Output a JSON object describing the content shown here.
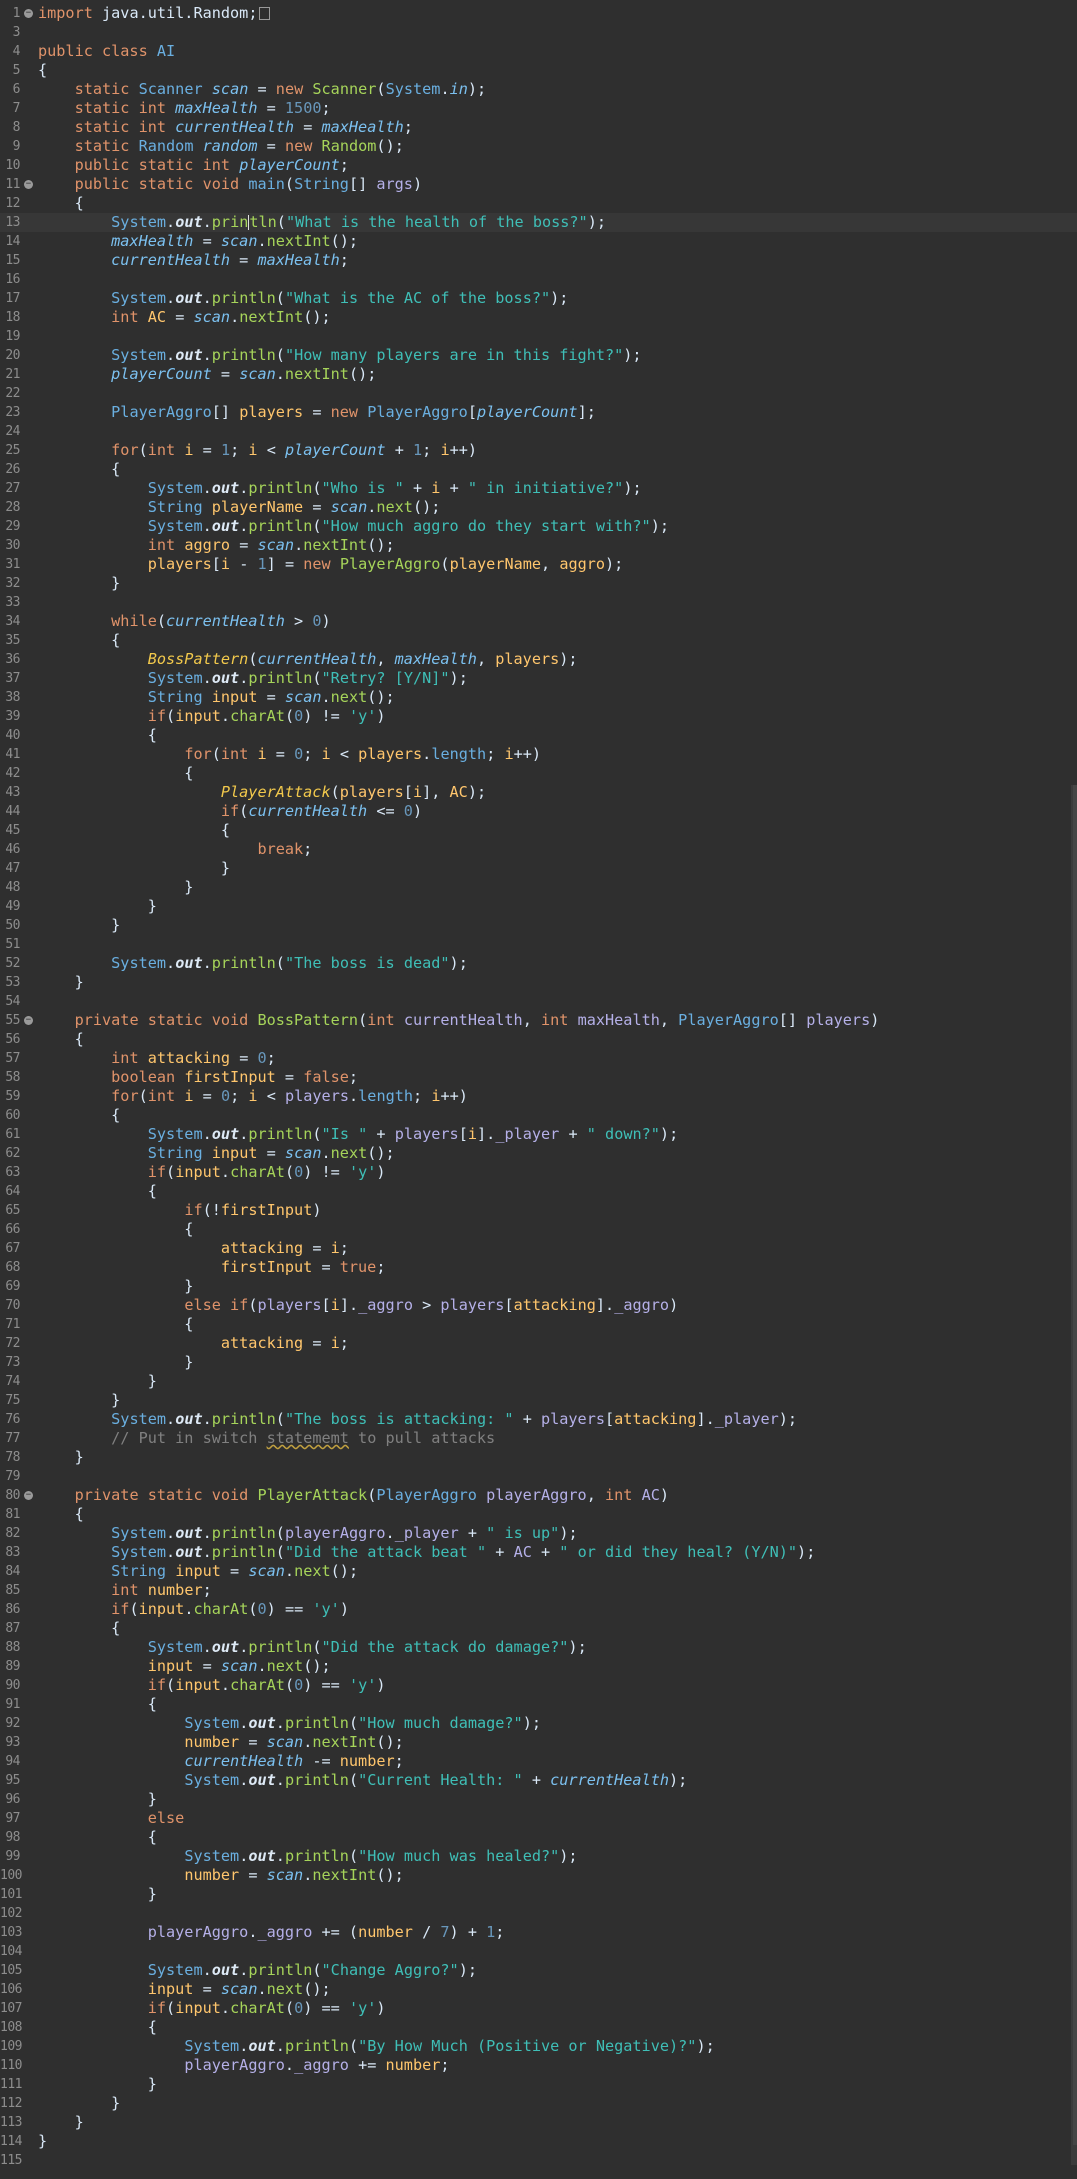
{
  "editor": {
    "language": "java",
    "current_line": 13,
    "lines": [
      {
        "n": "1",
        "fold": true,
        "html": "<span class='k'>import</span> java.util.Random;<span style='display:inline-block;width:9px;height:11px;border:1px solid #9a9a9a;vertical-align:middle;margin-left:2px'></span>"
      },
      {
        "n": "3",
        "html": ""
      },
      {
        "n": "4",
        "html": "<span class='k'>public class</span> <span class='t'>AI</span>"
      },
      {
        "n": "5",
        "html": "{"
      },
      {
        "n": "6",
        "html": "    <span class='k'>static</span> <span class='t'>Scanner</span> <span class='sf'>scan</span> = <span class='k'>new</span> <span class='f'>Scanner</span>(<span class='t'>System</span>.<span class='sf'>in</span>);"
      },
      {
        "n": "7",
        "html": "    <span class='k'>static int</span> <span class='sf'>maxHealth</span> = <span class='n'>1500</span>;"
      },
      {
        "n": "8",
        "html": "    <span class='k'>static int</span> <span class='sf'>currentHealth</span> = <span class='sf'>maxHealth</span>;"
      },
      {
        "n": "9",
        "html": "    <span class='k'>static</span> <span class='t'>Random</span> <span class='sf'>random</span> = <span class='k'>new</span> <span class='f'>Random</span>();"
      },
      {
        "n": "10",
        "html": "    <span class='k'>public static int</span> <span class='sf'>playerCount</span>;"
      },
      {
        "n": "11",
        "fold": true,
        "html": "    <span class='k'>public static void</span> <span class='t'>main</span>(<span class='t'>String</span>[] <span class='fld'>args</span>)"
      },
      {
        "n": "12",
        "html": "    {"
      },
      {
        "n": "13",
        "html": "        <span class='t'>System</span>.<span class='so'>out</span>.<span class='f'>prin</span><span class='cursor'></span><span class='f'>tln</span>(<span class='s'>\"What is the health of the boss?\"</span>);"
      },
      {
        "n": "14",
        "html": "        <span class='sf'>maxHealth</span> = <span class='sf'>scan</span>.<span class='f'>nextInt</span>();"
      },
      {
        "n": "15",
        "html": "        <span class='sf'>currentHealth</span> = <span class='sf'>maxHealth</span>;"
      },
      {
        "n": "16",
        "html": ""
      },
      {
        "n": "17",
        "html": "        <span class='t'>System</span>.<span class='so'>out</span>.<span class='f'>println</span>(<span class='s'>\"What is the AC of the boss?\"</span>);"
      },
      {
        "n": "18",
        "html": "        <span class='k'>int</span> <span class='p'>AC</span> = <span class='sf'>scan</span>.<span class='f'>nextInt</span>();"
      },
      {
        "n": "19",
        "html": ""
      },
      {
        "n": "20",
        "html": "        <span class='t'>System</span>.<span class='so'>out</span>.<span class='f'>println</span>(<span class='s'>\"How many players are in this fight?\"</span>);"
      },
      {
        "n": "21",
        "html": "        <span class='sf'>playerCount</span> = <span class='sf'>scan</span>.<span class='f'>nextInt</span>();"
      },
      {
        "n": "22",
        "html": ""
      },
      {
        "n": "23",
        "html": "        <span class='t'>PlayerAggro</span>[] <span class='p'>players</span> = <span class='k'>new</span> <span class='t'>PlayerAggro</span>[<span class='sf'>playerCount</span>];"
      },
      {
        "n": "24",
        "html": ""
      },
      {
        "n": "25",
        "html": "        <span class='k'>for</span>(<span class='k'>int</span> <span class='p'>i</span> = <span class='n'>1</span>; <span class='p'>i</span> &lt; <span class='sf'>playerCount</span> + <span class='n'>1</span>; <span class='p'>i</span>++)"
      },
      {
        "n": "26",
        "html": "        {"
      },
      {
        "n": "27",
        "html": "            <span class='t'>System</span>.<span class='so'>out</span>.<span class='f'>println</span>(<span class='s'>\"Who is \"</span> + <span class='p'>i</span> + <span class='s'>\" in initiative?\"</span>);"
      },
      {
        "n": "28",
        "html": "            <span class='t'>String</span> <span class='p'>playerName</span> = <span class='sf'>scan</span>.<span class='f'>next</span>();"
      },
      {
        "n": "29",
        "html": "            <span class='t'>System</span>.<span class='so'>out</span>.<span class='f'>println</span>(<span class='s'>\"How much aggro do they start with?\"</span>);"
      },
      {
        "n": "30",
        "html": "            <span class='k'>int</span> <span class='p'>aggro</span> = <span class='sf'>scan</span>.<span class='f'>nextInt</span>();"
      },
      {
        "n": "31",
        "html": "            <span class='p'>players</span>[<span class='p'>i</span> - <span class='n'>1</span>] = <span class='k'>new</span> <span class='f'>PlayerAggro</span>(<span class='p'>playerName</span>, <span class='p'>aggro</span>);"
      },
      {
        "n": "32",
        "html": "        }"
      },
      {
        "n": "33",
        "html": ""
      },
      {
        "n": "34",
        "html": "        <span class='k'>while</span>(<span class='sf'>currentHealth</span> &gt; <span class='n'>0</span>)"
      },
      {
        "n": "35",
        "html": "        {"
      },
      {
        "n": "36",
        "html": "            <span class='sm'>BossPattern</span>(<span class='sf'>currentHealth</span>, <span class='sf'>maxHealth</span>, <span class='p'>players</span>);"
      },
      {
        "n": "37",
        "html": "            <span class='t'>System</span>.<span class='so'>out</span>.<span class='f'>println</span>(<span class='s'>\"Retry? [Y/N]\"</span>);"
      },
      {
        "n": "38",
        "html": "            <span class='t'>String</span> <span class='p'>input</span> = <span class='sf'>scan</span>.<span class='f'>next</span>();"
      },
      {
        "n": "39",
        "html": "            <span class='k'>if</span>(<span class='p'>input</span>.<span class='f'>charAt</span>(<span class='n'>0</span>) != <span class='s'>'y'</span>)"
      },
      {
        "n": "40",
        "html": "            {"
      },
      {
        "n": "41",
        "html": "                <span class='k'>for</span>(<span class='k'>int</span> <span class='p'>i</span> = <span class='n'>0</span>; <span class='p'>i</span> &lt; <span class='p'>players</span>.<span class='t'>length</span>; <span class='p'>i</span>++)"
      },
      {
        "n": "42",
        "html": "                {"
      },
      {
        "n": "43",
        "html": "                    <span class='sm'>PlayerAttack</span>(<span class='p'>players</span>[<span class='p'>i</span>], <span class='p'>AC</span>);"
      },
      {
        "n": "44",
        "html": "                    <span class='k'>if</span>(<span class='sf'>currentHealth</span> &lt;= <span class='n'>0</span>)"
      },
      {
        "n": "45",
        "html": "                    {"
      },
      {
        "n": "46",
        "html": "                        <span class='k'>break</span>;"
      },
      {
        "n": "47",
        "html": "                    }"
      },
      {
        "n": "48",
        "html": "                }"
      },
      {
        "n": "49",
        "html": "            }"
      },
      {
        "n": "50",
        "html": "        }"
      },
      {
        "n": "51",
        "html": ""
      },
      {
        "n": "52",
        "html": "        <span class='t'>System</span>.<span class='so'>out</span>.<span class='f'>println</span>(<span class='s'>\"The boss is dead\"</span>);"
      },
      {
        "n": "53",
        "html": "    }"
      },
      {
        "n": "54",
        "html": ""
      },
      {
        "n": "55",
        "fold": true,
        "html": "    <span class='k'>private static void</span> <span class='f'>BossPattern</span>(<span class='k'>int</span> <span class='fld'>currentHealth</span>, <span class='k'>int</span> <span class='fld'>maxHealth</span>, <span class='t'>PlayerAggro</span>[] <span class='fld'>players</span>)"
      },
      {
        "n": "56",
        "html": "    {"
      },
      {
        "n": "57",
        "html": "        <span class='k'>int</span> <span class='p'>attacking</span> = <span class='n'>0</span>;"
      },
      {
        "n": "58",
        "html": "        <span class='k'>boolean</span> <span class='p'>firstInput</span> = <span class='k'>false</span>;"
      },
      {
        "n": "59",
        "html": "        <span class='k'>for</span>(<span class='k'>int</span> <span class='p'>i</span> = <span class='n'>0</span>; <span class='p'>i</span> &lt; <span class='fld'>players</span>.<span class='t'>length</span>; <span class='p'>i</span>++)"
      },
      {
        "n": "60",
        "html": "        {"
      },
      {
        "n": "61",
        "html": "            <span class='t'>System</span>.<span class='so'>out</span>.<span class='f'>println</span>(<span class='s'>\"Is \"</span> + <span class='fld'>players</span>[<span class='p'>i</span>].<span class='fld'>_player</span> + <span class='s'>\" down?\"</span>);"
      },
      {
        "n": "62",
        "html": "            <span class='t'>String</span> <span class='p'>input</span> = <span class='sf'>scan</span>.<span class='f'>next</span>();"
      },
      {
        "n": "63",
        "html": "            <span class='k'>if</span>(<span class='p'>input</span>.<span class='f'>charAt</span>(<span class='n'>0</span>) != <span class='s'>'y'</span>)"
      },
      {
        "n": "64",
        "html": "            {"
      },
      {
        "n": "65",
        "html": "                <span class='k'>if</span>(!<span class='p'>firstInput</span>)"
      },
      {
        "n": "66",
        "html": "                {"
      },
      {
        "n": "67",
        "html": "                    <span class='p'>attacking</span> = <span class='p'>i</span>;"
      },
      {
        "n": "68",
        "html": "                    <span class='p'>firstInput</span> = <span class='k'>true</span>;"
      },
      {
        "n": "69",
        "html": "                }"
      },
      {
        "n": "70",
        "html": "                <span class='k'>else if</span>(<span class='fld'>players</span>[<span class='p'>i</span>].<span class='fld'>_aggro</span> &gt; <span class='fld'>players</span>[<span class='p'>attacking</span>].<span class='fld'>_aggro</span>)"
      },
      {
        "n": "71",
        "html": "                {"
      },
      {
        "n": "72",
        "html": "                    <span class='p'>attacking</span> = <span class='p'>i</span>;"
      },
      {
        "n": "73",
        "html": "                }"
      },
      {
        "n": "74",
        "html": "            }"
      },
      {
        "n": "75",
        "html": "        }"
      },
      {
        "n": "76",
        "html": "        <span class='t'>System</span>.<span class='so'>out</span>.<span class='f'>println</span>(<span class='s'>\"The boss is attacking: \"</span> + <span class='fld'>players</span>[<span class='p'>attacking</span>].<span class='fld'>_player</span>);"
      },
      {
        "n": "77",
        "html": "        <span class='c'>// Put in switch <span style='text-decoration:underline wavy #c0a040'>statememt</span> to pull attacks</span>"
      },
      {
        "n": "78",
        "html": "    }"
      },
      {
        "n": "79",
        "html": ""
      },
      {
        "n": "80",
        "fold": true,
        "html": "    <span class='k'>private static void</span> <span class='f'>PlayerAttack</span>(<span class='t'>PlayerAggro</span> <span class='fld'>playerAggro</span>, <span class='k'>int</span> <span class='fld'>AC</span>)"
      },
      {
        "n": "81",
        "html": "    {"
      },
      {
        "n": "82",
        "html": "        <span class='t'>System</span>.<span class='so'>out</span>.<span class='f'>println</span>(<span class='fld'>playerAggro</span>.<span class='fld'>_player</span> + <span class='s'>\" is up\"</span>);"
      },
      {
        "n": "83",
        "html": "        <span class='t'>System</span>.<span class='so'>out</span>.<span class='f'>println</span>(<span class='s'>\"Did the attack beat \"</span> + <span class='fld'>AC</span> + <span class='s'>\" or did they heal? (Y/N)\"</span>);"
      },
      {
        "n": "84",
        "html": "        <span class='t'>String</span> <span class='p'>input</span> = <span class='sf'>scan</span>.<span class='f'>next</span>();"
      },
      {
        "n": "85",
        "html": "        <span class='k'>int</span> <span class='p'>number</span>;"
      },
      {
        "n": "86",
        "html": "        <span class='k'>if</span>(<span class='p'>input</span>.<span class='f'>charAt</span>(<span class='n'>0</span>) == <span class='s'>'y'</span>)"
      },
      {
        "n": "87",
        "html": "        {"
      },
      {
        "n": "88",
        "html": "            <span class='t'>System</span>.<span class='so'>out</span>.<span class='f'>println</span>(<span class='s'>\"Did the attack do damage?\"</span>);"
      },
      {
        "n": "89",
        "html": "            <span class='p'>input</span> = <span class='sf'>scan</span>.<span class='f'>next</span>();"
      },
      {
        "n": "90",
        "html": "            <span class='k'>if</span>(<span class='p'>input</span>.<span class='f'>charAt</span>(<span class='n'>0</span>) == <span class='s'>'y'</span>)"
      },
      {
        "n": "91",
        "html": "            {"
      },
      {
        "n": "92",
        "html": "                <span class='t'>System</span>.<span class='so'>out</span>.<span class='f'>println</span>(<span class='s'>\"How much damage?\"</span>);"
      },
      {
        "n": "93",
        "html": "                <span class='p'>number</span> = <span class='sf'>scan</span>.<span class='f'>nextInt</span>();"
      },
      {
        "n": "94",
        "html": "                <span class='sf'>currentHealth</span> -= <span class='p'>number</span>;"
      },
      {
        "n": "95",
        "html": "                <span class='t'>System</span>.<span class='so'>out</span>.<span class='f'>println</span>(<span class='s'>\"Current Health: \"</span> + <span class='sf'>currentHealth</span>);"
      },
      {
        "n": "96",
        "html": "            }"
      },
      {
        "n": "97",
        "html": "            <span class='k'>else</span>"
      },
      {
        "n": "98",
        "html": "            {"
      },
      {
        "n": "99",
        "html": "                <span class='t'>System</span>.<span class='so'>out</span>.<span class='f'>println</span>(<span class='s'>\"How much was healed?\"</span>);"
      },
      {
        "n": "100",
        "html": "                <span class='p'>number</span> = <span class='sf'>scan</span>.<span class='f'>nextInt</span>();"
      },
      {
        "n": "101",
        "html": "            }"
      },
      {
        "n": "102",
        "html": ""
      },
      {
        "n": "103",
        "html": "            <span class='fld'>playerAggro</span>.<span class='fld'>_aggro</span> += (<span class='p'>number</span> / <span class='n'>7</span>) + <span class='n'>1</span>;"
      },
      {
        "n": "104",
        "html": ""
      },
      {
        "n": "105",
        "html": "            <span class='t'>System</span>.<span class='so'>out</span>.<span class='f'>println</span>(<span class='s'>\"Change Aggro?\"</span>);"
      },
      {
        "n": "106",
        "html": "            <span class='p'>input</span> = <span class='sf'>scan</span>.<span class='f'>next</span>();"
      },
      {
        "n": "107",
        "html": "            <span class='k'>if</span>(<span class='p'>input</span>.<span class='f'>charAt</span>(<span class='n'>0</span>) == <span class='s'>'y'</span>)"
      },
      {
        "n": "108",
        "html": "            {"
      },
      {
        "n": "109",
        "html": "                <span class='t'>System</span>.<span class='so'>out</span>.<span class='f'>println</span>(<span class='s'>\"By How Much (Positive or Negative)?\"</span>);"
      },
      {
        "n": "110",
        "html": "                <span class='fld'>playerAggro</span>.<span class='fld'>_aggro</span> += <span class='p'>number</span>;"
      },
      {
        "n": "111",
        "html": "            }"
      },
      {
        "n": "112",
        "html": "        }"
      },
      {
        "n": "113",
        "html": "    }"
      },
      {
        "n": "114",
        "html": "}"
      },
      {
        "n": "115",
        "html": ""
      }
    ]
  }
}
